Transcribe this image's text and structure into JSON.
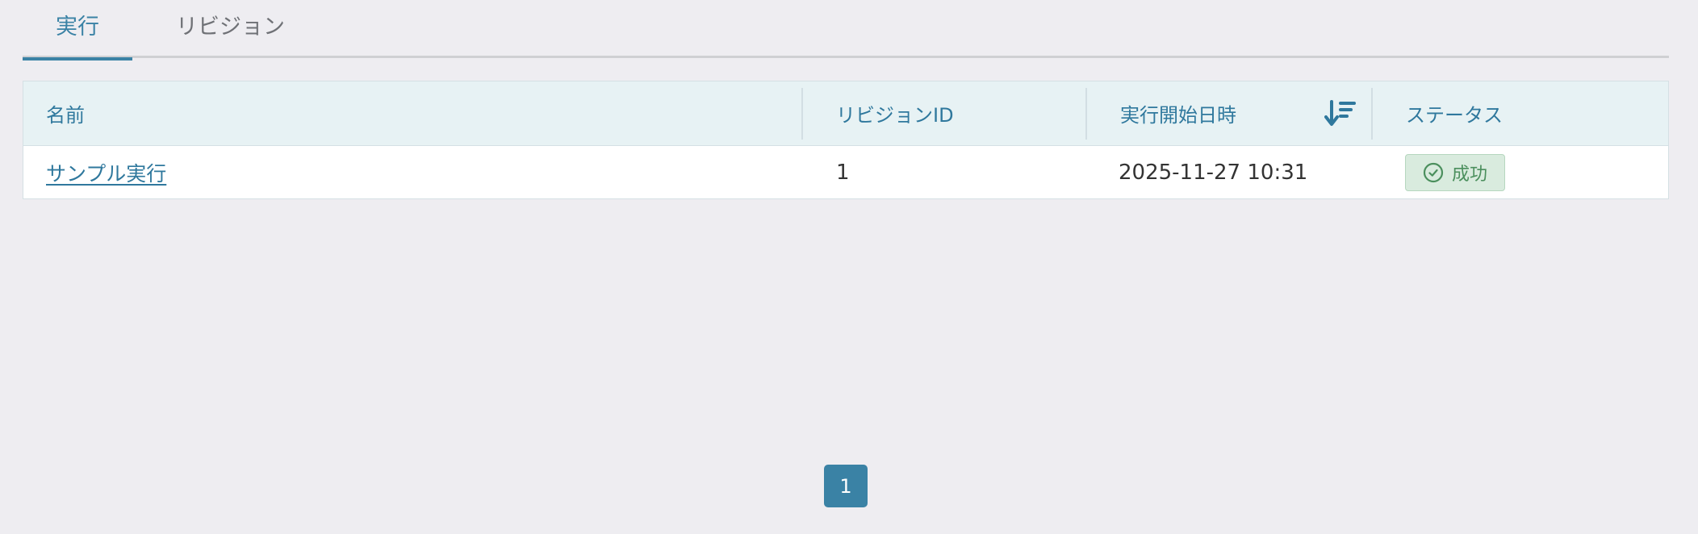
{
  "tabs": [
    {
      "label": "実行",
      "active": true
    },
    {
      "label": "リビジョン",
      "active": false
    }
  ],
  "table": {
    "columns": [
      "名前",
      "リビジョンID",
      "実行開始日時",
      "ステータス"
    ],
    "rows": [
      {
        "name": "サンプル実行",
        "revision_id": "1",
        "started_at": "2025-11-27 10:31",
        "status": "成功"
      }
    ]
  },
  "pagination": {
    "current_page": "1"
  },
  "icons": {
    "sort": "sort-descending-icon",
    "status": "check-circle-icon"
  },
  "colors": {
    "accent": "#3a82a5",
    "header_bg": "#e7f2f4",
    "success_bg": "#d9ebde",
    "success_text": "#4b8f5d",
    "page_bg": "#eeedf1"
  }
}
